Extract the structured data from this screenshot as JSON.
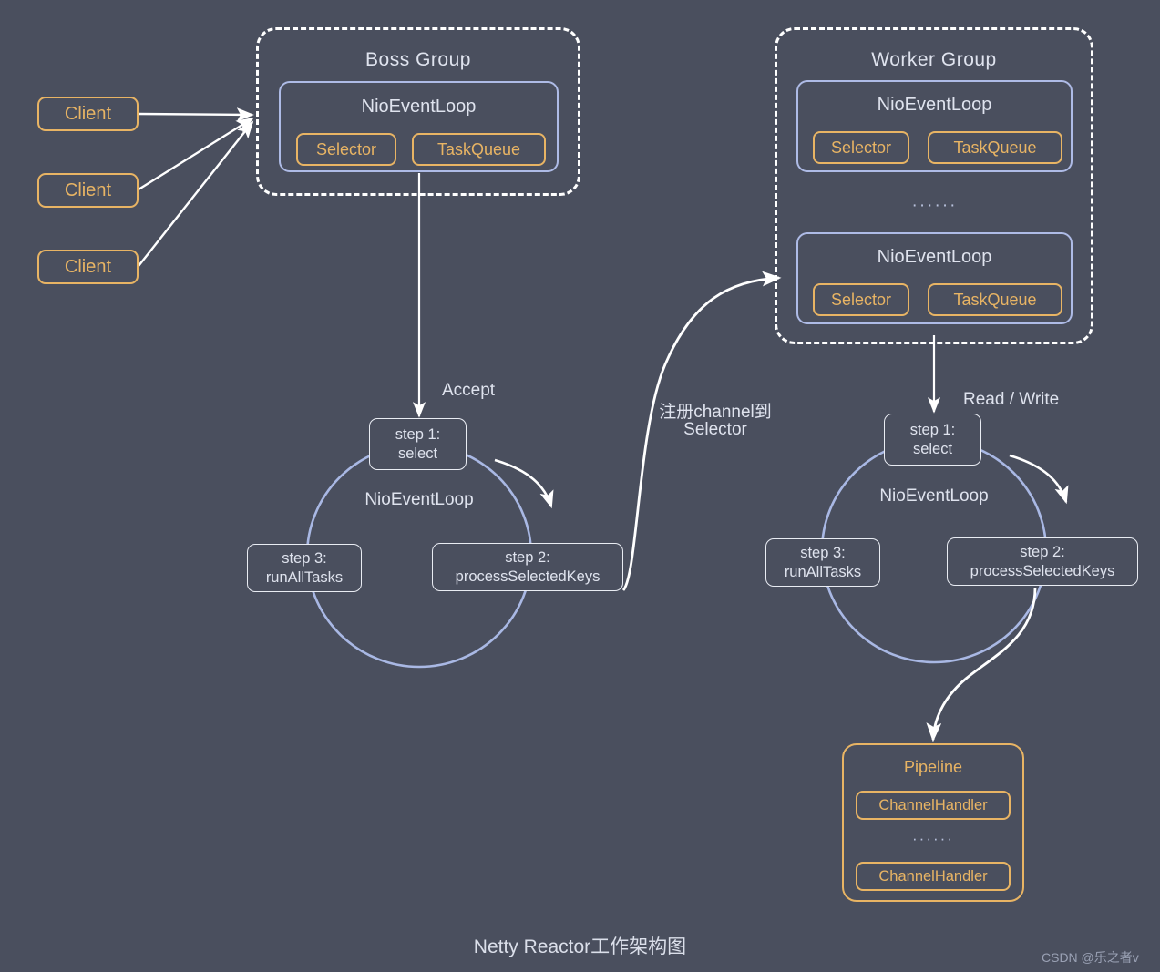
{
  "diagram": {
    "caption": "Netty Reactor工作架构图",
    "watermark": "CSDN @乐之者v",
    "colors": {
      "background": "#4a4f5e",
      "accent_orange": "#e8b464",
      "accent_periwinkle": "#aebbe6",
      "text_light": "#dfe3ee",
      "arrow_white": "#ffffff"
    }
  },
  "clients": [
    {
      "label": "Client"
    },
    {
      "label": "Client"
    },
    {
      "label": "Client"
    }
  ],
  "boss_group": {
    "title": "Boss Group",
    "event_loops": [
      {
        "title": "NioEventLoop",
        "selector_label": "Selector",
        "taskqueue_label": "TaskQueue"
      }
    ]
  },
  "worker_group": {
    "title": "Worker Group",
    "ellipsis": "······",
    "event_loops": [
      {
        "title": "NioEventLoop",
        "selector_label": "Selector",
        "taskqueue_label": "TaskQueue"
      },
      {
        "title": "NioEventLoop",
        "selector_label": "Selector",
        "taskqueue_label": "TaskQueue"
      }
    ]
  },
  "boss_loop": {
    "arrow_label": "Accept",
    "center_label": "NioEventLoop",
    "steps": [
      {
        "line1": "step 1:",
        "line2": "select"
      },
      {
        "line1": "step 2:",
        "line2": "processSelectedKeys"
      },
      {
        "line1": "step 3:",
        "line2": "runAllTasks"
      }
    ]
  },
  "worker_loop": {
    "arrow_label": "Read / Write",
    "center_label": "NioEventLoop",
    "steps": [
      {
        "line1": "step 1:",
        "line2": "select"
      },
      {
        "line1": "step 2:",
        "line2": "processSelectedKeys"
      },
      {
        "line1": "step 3:",
        "line2": "runAllTasks"
      }
    ]
  },
  "register_arrow": {
    "line1": "注册channel到",
    "line2": "Selector"
  },
  "pipeline": {
    "title": "Pipeline",
    "ellipsis": "······",
    "handlers": [
      {
        "label": "ChannelHandler"
      },
      {
        "label": "ChannelHandler"
      }
    ]
  }
}
